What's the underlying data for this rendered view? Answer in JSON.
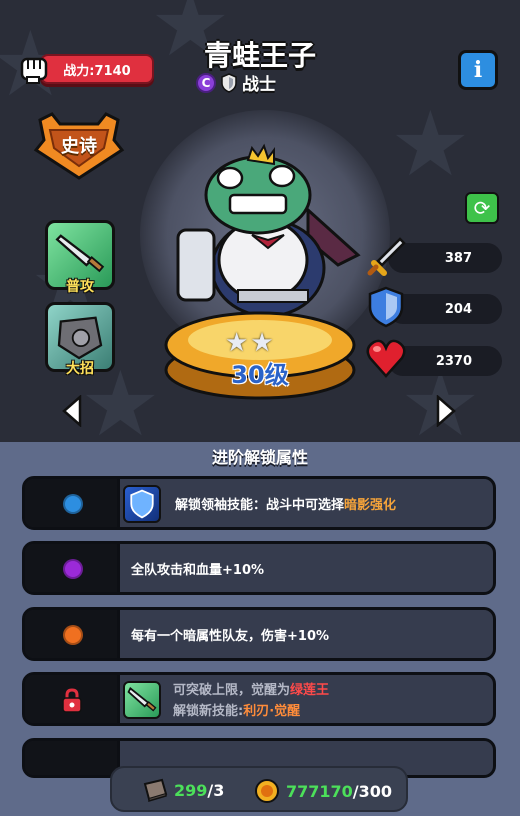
{
  "hero": {
    "name": "青蛙王子",
    "class_badge": "C",
    "class_name": "战士",
    "rarity": "史诗",
    "level": "30级",
    "star_count": 2
  },
  "power": {
    "label": "战力:7140"
  },
  "info_button": {
    "label": "i"
  },
  "skills": [
    {
      "label": "普攻",
      "icon": "sword-icon"
    },
    {
      "label": "大招",
      "icon": "stone-shield-icon"
    }
  ],
  "stats": {
    "attack": "387",
    "defense": "204",
    "hp": "2370"
  },
  "colors": {
    "accent_orange": "#f6a43a",
    "power_red": "#e0303f",
    "dot_blue": "#2d8ee0",
    "dot_purple": "#9b2ad8",
    "dot_orange": "#f07020",
    "lock_red": "#e0303f"
  },
  "section": {
    "title": "进阶解锁属性"
  },
  "unlocks": [
    {
      "dot": "blue",
      "prefix": "解锁领袖技能：战斗中可选择",
      "highlight": "暗影强化"
    },
    {
      "dot": "purple",
      "text": "全队攻击和血量+10%"
    },
    {
      "dot": "orange",
      "text": "每有一个暗属性队友，伤害+10%"
    },
    {
      "dot": "lock",
      "line1_prefix": "可突破上限，觉醒为",
      "line1_highlight": "绿莲王",
      "line2_prefix": "解锁新技能:",
      "line2_highlight": "利刃·觉醒"
    }
  ],
  "resources": {
    "book_have": "299",
    "book_need": "/3",
    "coin_have": "777170",
    "coin_need": "/300"
  }
}
